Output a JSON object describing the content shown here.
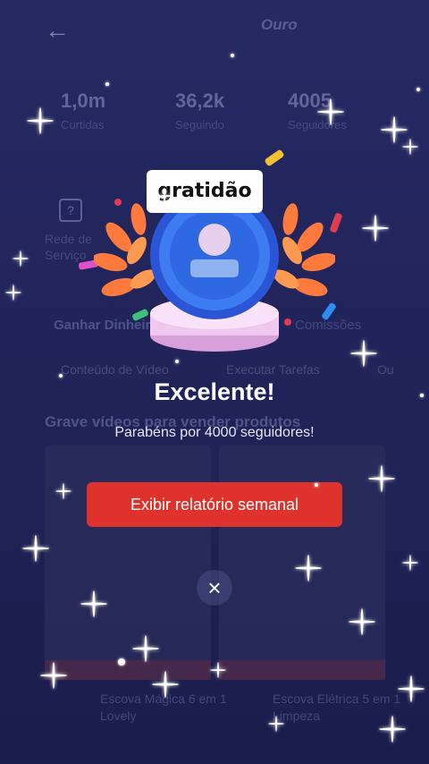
{
  "background": {
    "back_icon": "←",
    "shop_title": "Ouro",
    "stats": [
      {
        "num": "1,0m",
        "label": "Curtidas"
      },
      {
        "num": "36,2k",
        "label": "Seguindo"
      },
      {
        "num": "4005",
        "label": "Seguidores"
      }
    ],
    "help_icon": "?",
    "help_label": "Rede de Serviço",
    "earn_title": "Ganhar Dinheiro",
    "earn_right": "Comissões",
    "tabs": [
      "Conteúdo de Vídeo",
      "Executar Tarefas",
      "Ou"
    ],
    "section_title": "Grave vídeos para vender produtos",
    "products": [
      {
        "title": "Escova Mágica 6 em 1 Lovely"
      },
      {
        "title": "Escova Elétrica 5 em 1 Limpeza"
      }
    ]
  },
  "popup": {
    "badge_label": "gratidão",
    "title": "Excelente!",
    "subtitle": "Parabéns por 4000 seguidores!",
    "report_button": "Exibir relatório semanal",
    "close_icon": "×"
  },
  "colors": {
    "primary_button": "#e0322d",
    "background": "#22265a",
    "medal_blue": "#2f6ee6",
    "laurel": "#ff7a3c"
  }
}
